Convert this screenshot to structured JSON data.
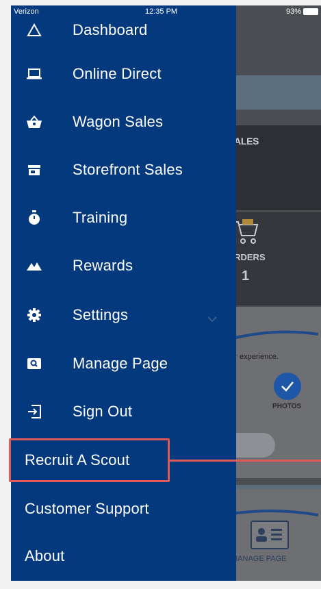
{
  "status_bar": {
    "carrier": "Verizon",
    "time": "12:35 PM",
    "battery": "93%"
  },
  "menu": {
    "items": [
      {
        "label": "Dashboard",
        "icon": "triangle-icon"
      },
      {
        "label": "Online Direct",
        "icon": "laptop-icon"
      },
      {
        "label": "Wagon Sales",
        "icon": "basket-icon"
      },
      {
        "label": "Storefront Sales",
        "icon": "storefront-icon"
      },
      {
        "label": "Training",
        "icon": "stopwatch-icon"
      },
      {
        "label": "Rewards",
        "icon": "mountains-icon"
      },
      {
        "label": "Settings",
        "icon": "gear-icon"
      },
      {
        "label": "Manage Page",
        "icon": "search-card-icon"
      },
      {
        "label": "Sign Out",
        "icon": "sign-out-icon"
      }
    ],
    "extra_items": [
      {
        "label": "Recruit A Scout"
      },
      {
        "label": "Customer Support"
      },
      {
        "label": "About"
      }
    ]
  },
  "background": {
    "sales_label": "SALES",
    "orders_label": "ORDERS",
    "orders_count": "1",
    "experience_text": "mer experience.",
    "photos_label": "PHOTOS",
    "manage_page_label": "MANAGE PAGE"
  },
  "colors": {
    "drawer": "#05397e",
    "highlight": "#e05a5a",
    "accent_orange": "#d49a1c"
  }
}
